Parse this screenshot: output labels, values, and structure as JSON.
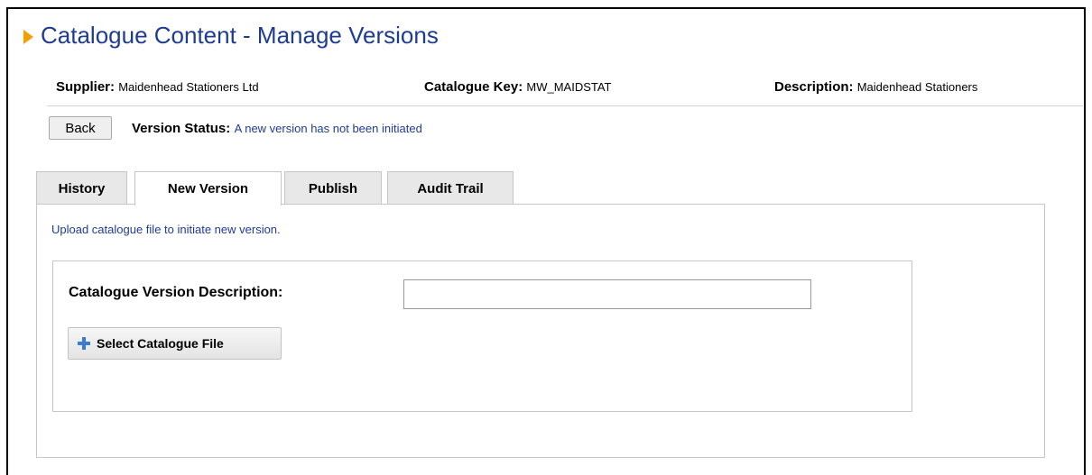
{
  "page": {
    "title": "Catalogue Content - Manage Versions"
  },
  "info": {
    "supplier_label": "Supplier:",
    "supplier_value": "Maidenhead Stationers Ltd",
    "catalogue_key_label": "Catalogue Key:",
    "catalogue_key_value": "MW_MAIDSTAT",
    "description_label": "Description:",
    "description_value": "Maidenhead Stationers"
  },
  "actions": {
    "back_label": "Back"
  },
  "status": {
    "label": "Version Status:",
    "value": "A new version has not been initiated"
  },
  "tabs": [
    {
      "label": "History",
      "active": false
    },
    {
      "label": "New Version",
      "active": true
    },
    {
      "label": "Publish",
      "active": false
    },
    {
      "label": "Audit Trail",
      "active": false
    }
  ],
  "new_version": {
    "hint": "Upload catalogue file to initiate new version.",
    "description_label": "Catalogue Version Description:",
    "description_value": "",
    "select_file_label": "Select Catalogue File"
  },
  "colors": {
    "title_blue": "#1f3c93",
    "arrow_orange": "#f0a000",
    "plus_blue": "#3a7dd0"
  },
  "icons": {
    "title_marker": "triangle-right-icon",
    "select_file": "plus-icon"
  }
}
